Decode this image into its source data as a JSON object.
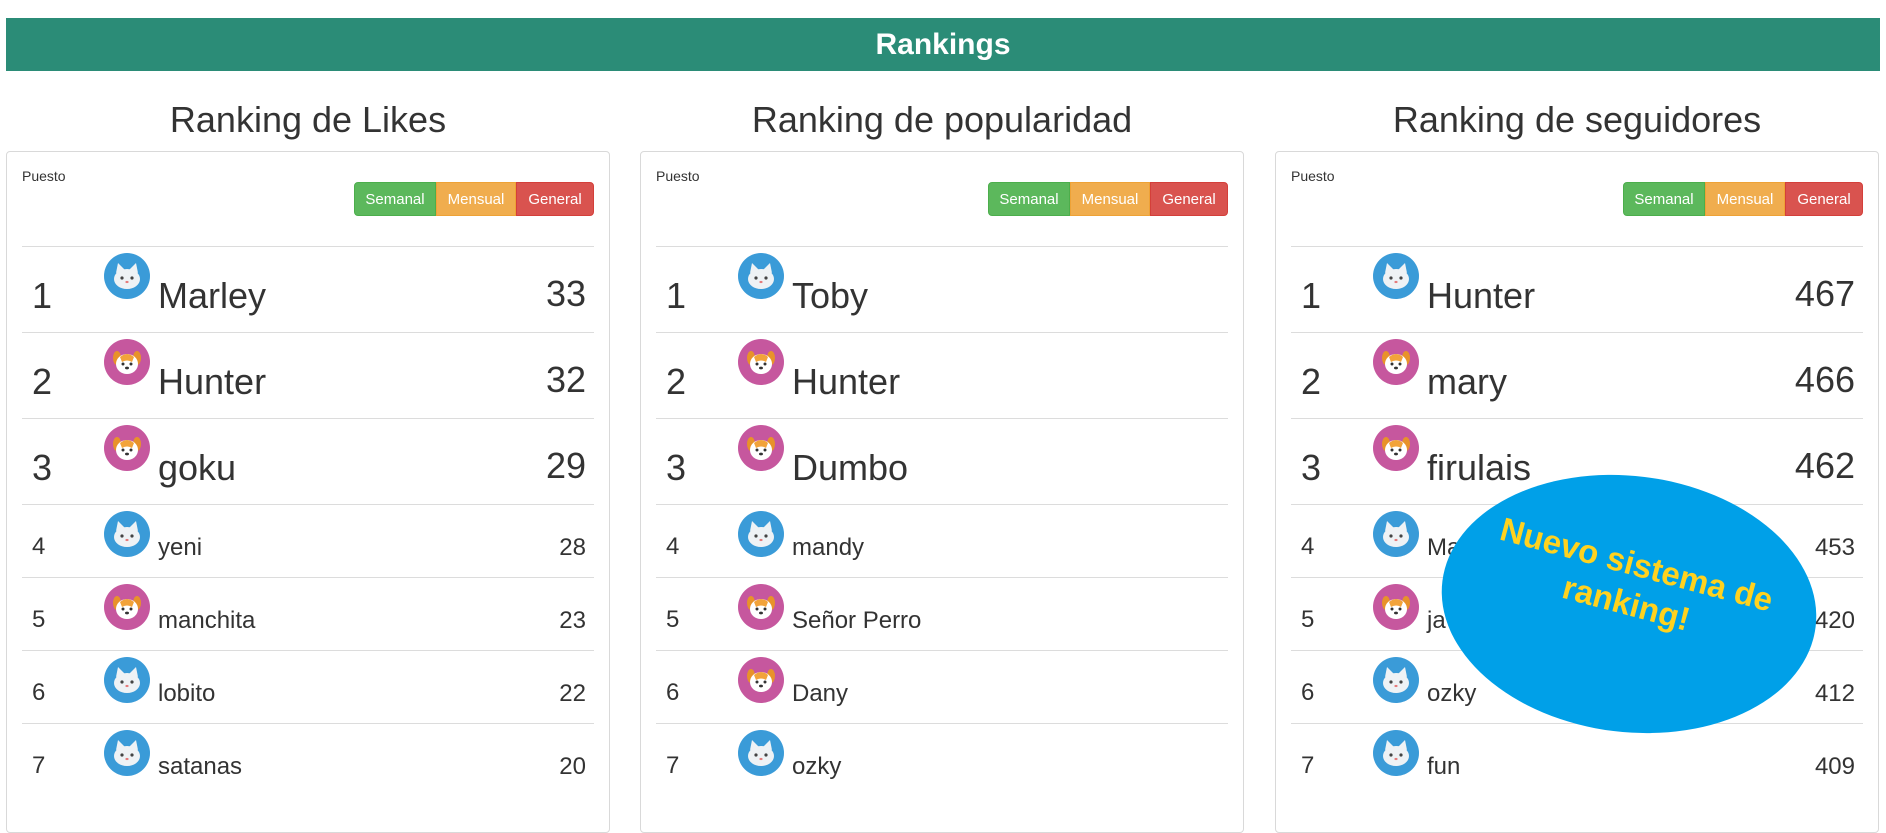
{
  "header": {
    "title": "Rankings"
  },
  "common": {
    "puesto": "Puesto",
    "filters": [
      "Semanal",
      "Mensual",
      "General"
    ]
  },
  "badge": {
    "text": "Nuevo sistema de ranking!"
  },
  "columns": [
    {
      "title": "Ranking de Likes",
      "rows": [
        {
          "rank": "1",
          "name": "Marley",
          "score": "33",
          "avatar": "cat-icon"
        },
        {
          "rank": "2",
          "name": "Hunter",
          "score": "32",
          "avatar": "dog-icon"
        },
        {
          "rank": "3",
          "name": "goku",
          "score": "29",
          "avatar": "dog-icon"
        },
        {
          "rank": "4",
          "name": "yeni",
          "score": "28",
          "avatar": "cat-icon"
        },
        {
          "rank": "5",
          "name": "manchita",
          "score": "23",
          "avatar": "dog-icon"
        },
        {
          "rank": "6",
          "name": "lobito",
          "score": "22",
          "avatar": "cat-icon"
        },
        {
          "rank": "7",
          "name": "satanas",
          "score": "20",
          "avatar": "cat-icon"
        }
      ]
    },
    {
      "title": "Ranking de popularidad",
      "rows": [
        {
          "rank": "1",
          "name": "Toby",
          "score": "",
          "avatar": "cat-icon"
        },
        {
          "rank": "2",
          "name": "Hunter",
          "score": "",
          "avatar": "dog-icon"
        },
        {
          "rank": "3",
          "name": "Dumbo",
          "score": "",
          "avatar": "dog-icon"
        },
        {
          "rank": "4",
          "name": "mandy",
          "score": "",
          "avatar": "cat-icon"
        },
        {
          "rank": "5",
          "name": "Señor Perro",
          "score": "",
          "avatar": "dog-icon"
        },
        {
          "rank": "6",
          "name": "Dany",
          "score": "",
          "avatar": "dog-icon"
        },
        {
          "rank": "7",
          "name": "ozky",
          "score": "",
          "avatar": "cat-icon"
        }
      ]
    },
    {
      "title": "Ranking de seguidores",
      "rows": [
        {
          "rank": "1",
          "name": "Hunter",
          "score": "467",
          "avatar": "cat-icon"
        },
        {
          "rank": "2",
          "name": "mary",
          "score": "466",
          "avatar": "dog-icon"
        },
        {
          "rank": "3",
          "name": "firulais",
          "score": "462",
          "avatar": "dog-icon"
        },
        {
          "rank": "4",
          "name": "Ma",
          "score": "453",
          "avatar": "cat-icon"
        },
        {
          "rank": "5",
          "name": "ja",
          "score": "420",
          "avatar": "dog-icon"
        },
        {
          "rank": "6",
          "name": "ozky",
          "score": "412",
          "avatar": "cat-icon"
        },
        {
          "rank": "7",
          "name": "fun",
          "score": "409",
          "avatar": "cat-icon"
        }
      ]
    }
  ]
}
